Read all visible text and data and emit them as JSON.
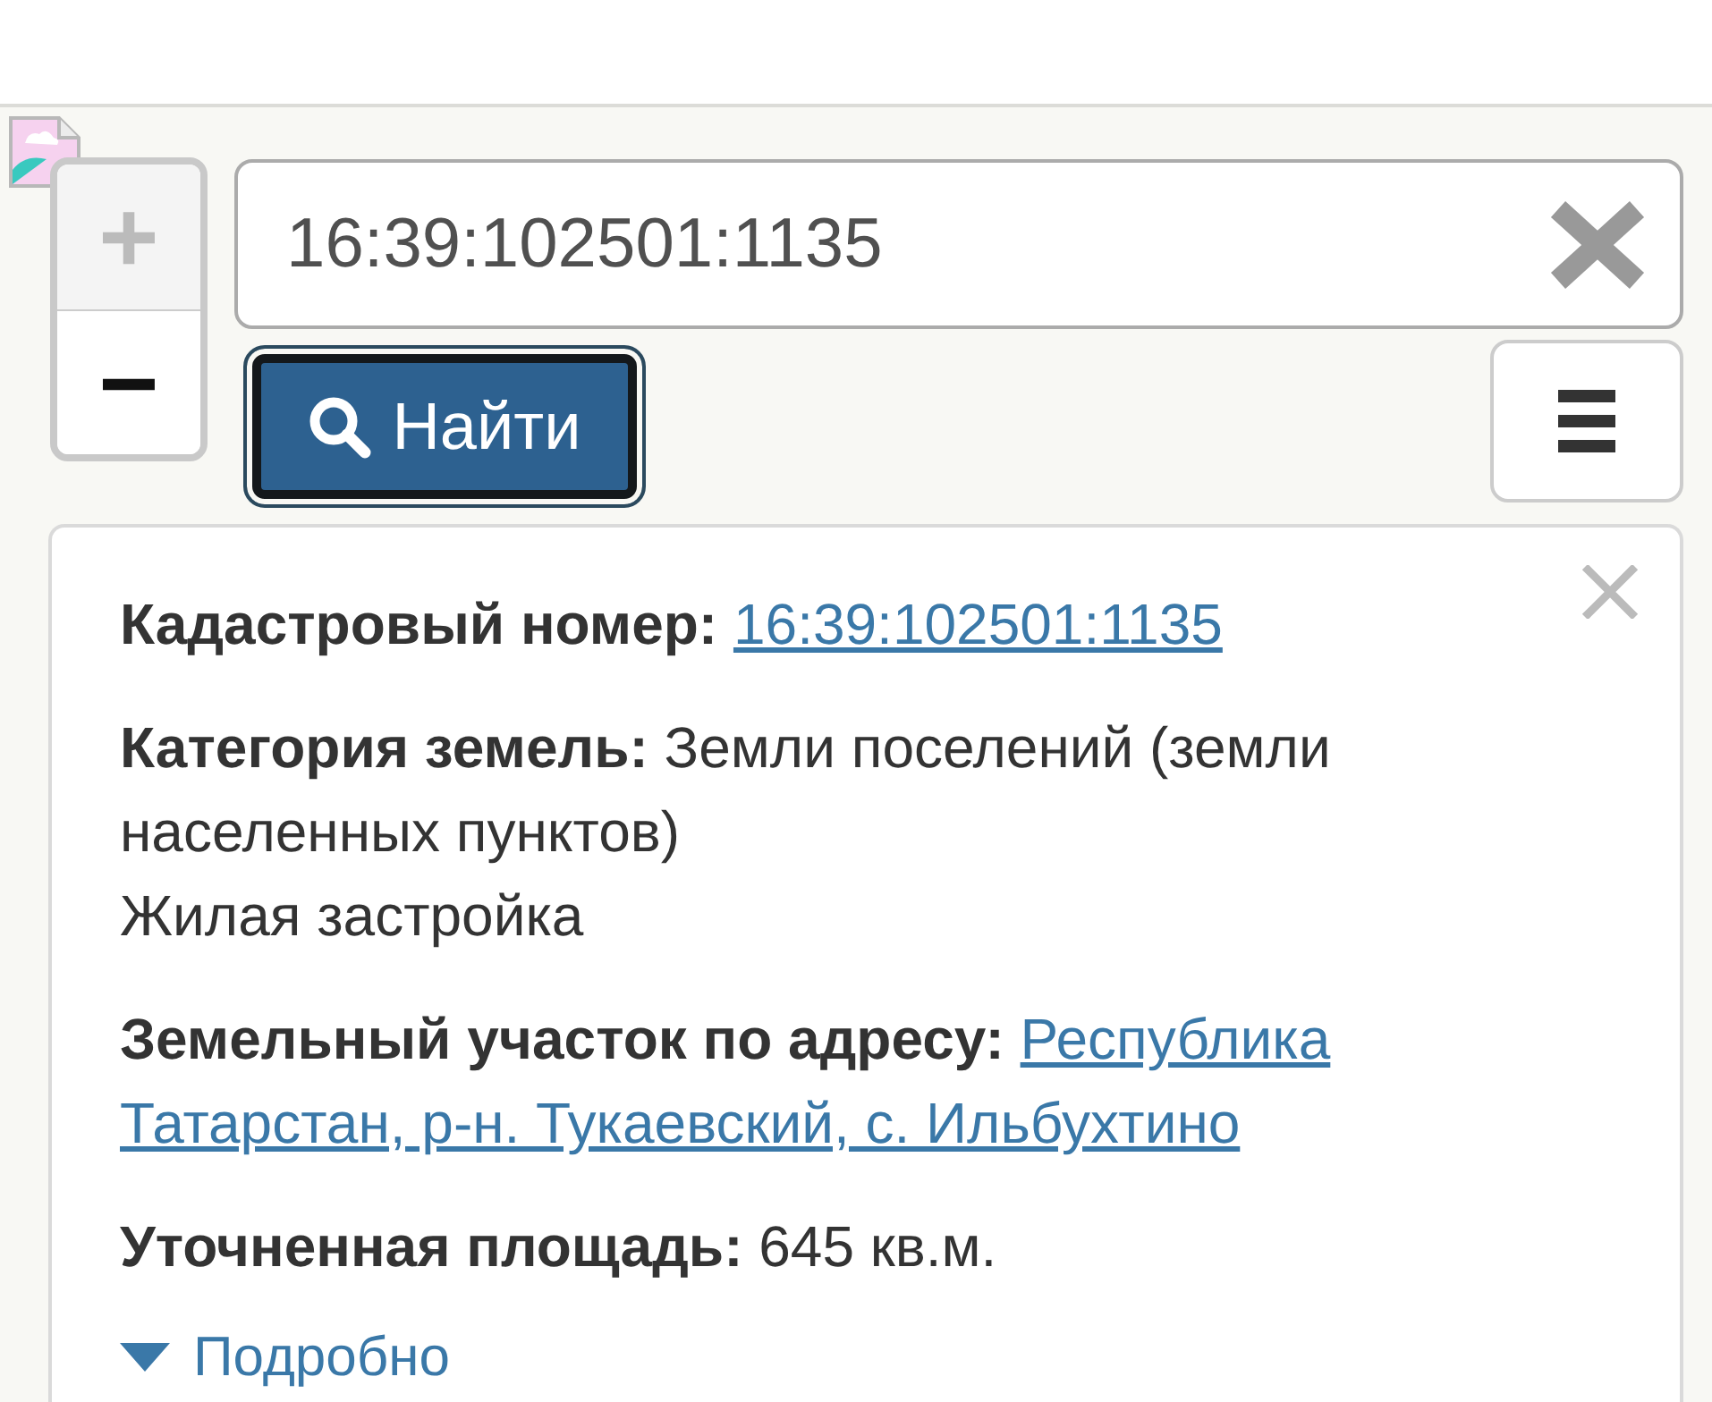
{
  "zoom_buttons": [
    {
      "label": "+",
      "disabled": true
    },
    {
      "label": "−",
      "disabled": false
    }
  ],
  "search": {
    "value": "16:39:102501:1135",
    "button": "Найти"
  },
  "popup": {
    "fields": [
      {
        "kind": "link",
        "label": "Кадастровый номер:",
        "value": "16:39:102501:1135"
      },
      {
        "kind": "text",
        "label": "Категория земель:",
        "value": "Земли поселений (земли населенных пунктов)",
        "second_line": "Жилая застройка"
      },
      {
        "kind": "link",
        "label": "Земельный участок по адресу:",
        "value": "Республика Татарстан, р-н. Тукаевский, с. Ильбухтино"
      },
      {
        "kind": "text",
        "label": "Уточненная площадь:",
        "value": "645 кв.м."
      }
    ],
    "details": {
      "label": "Подробно",
      "expanded": false
    }
  }
}
